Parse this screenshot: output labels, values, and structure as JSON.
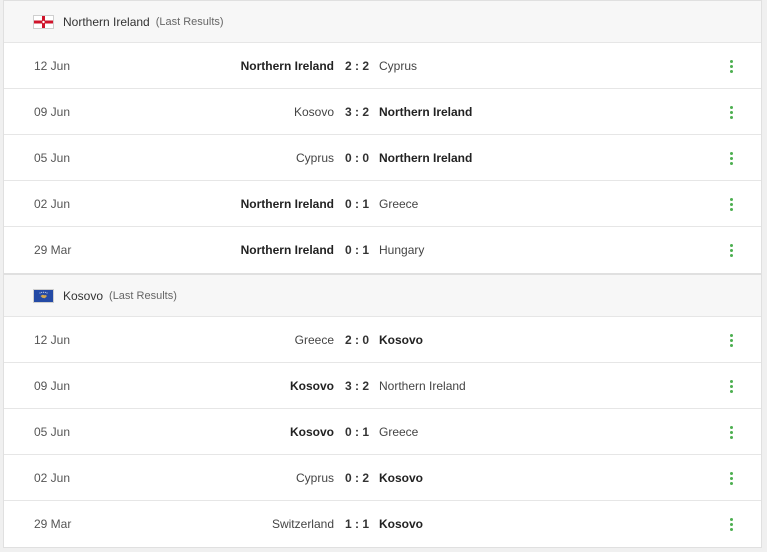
{
  "sections": [
    {
      "team": "Northern Ireland",
      "subtitle": "(Last Results)",
      "flag_icon": "northern-ireland-flag-icon",
      "matches": [
        {
          "date": "12 Jun",
          "home": "Northern Ireland",
          "score": "2 : 2",
          "away": "Cyprus",
          "bold": "home"
        },
        {
          "date": "09 Jun",
          "home": "Kosovo",
          "score": "3 : 2",
          "away": "Northern Ireland",
          "bold": "away"
        },
        {
          "date": "05 Jun",
          "home": "Cyprus",
          "score": "0 : 0",
          "away": "Northern Ireland",
          "bold": "away"
        },
        {
          "date": "02 Jun",
          "home": "Northern Ireland",
          "score": "0 : 1",
          "away": "Greece",
          "bold": "home"
        },
        {
          "date": "29 Mar",
          "home": "Northern Ireland",
          "score": "0 : 1",
          "away": "Hungary",
          "bold": "home"
        }
      ]
    },
    {
      "team": "Kosovo",
      "subtitle": "(Last Results)",
      "flag_icon": "kosovo-flag-icon",
      "matches": [
        {
          "date": "12 Jun",
          "home": "Greece",
          "score": "2 : 0",
          "away": "Kosovo",
          "bold": "away"
        },
        {
          "date": "09 Jun",
          "home": "Kosovo",
          "score": "3 : 2",
          "away": "Northern Ireland",
          "bold": "home"
        },
        {
          "date": "05 Jun",
          "home": "Kosovo",
          "score": "0 : 1",
          "away": "Greece",
          "bold": "home"
        },
        {
          "date": "02 Jun",
          "home": "Cyprus",
          "score": "0 : 2",
          "away": "Kosovo",
          "bold": "away"
        },
        {
          "date": "29 Mar",
          "home": "Switzerland",
          "score": "1 : 1",
          "away": "Kosovo",
          "bold": "away"
        }
      ]
    }
  ],
  "colors": {
    "menu_dots": "#4caf50",
    "header_bg": "#f7f7f7",
    "kosovo_flag_blue": "#244AA5",
    "kosovo_flag_gold": "#D0A650",
    "ni_flag_red": "#CF142B"
  },
  "icons": {
    "row_menu": "more-vertical-icon"
  }
}
